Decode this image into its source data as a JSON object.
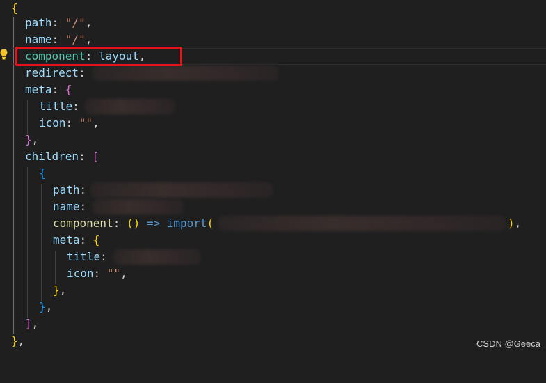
{
  "editor": {
    "lines": [
      {
        "open_brace": "{"
      },
      {
        "key": "path",
        "colon": ": ",
        "value": "\"/\"",
        "comma": ","
      },
      {
        "key": "name",
        "colon": ": ",
        "value": "\"/\"",
        "comma": ","
      },
      {
        "key": "component",
        "colon": ": ",
        "value": "layout",
        "comma": ","
      },
      {
        "key": "redirect",
        "colon": ":"
      },
      {
        "key": "meta",
        "colon": ": ",
        "bracket": "{"
      },
      {
        "key": "title",
        "colon": ":"
      },
      {
        "key": "icon",
        "colon": ": ",
        "value": "\"\"",
        "comma": ","
      },
      {
        "bracket": "}",
        "comma": ","
      },
      {
        "key": "children",
        "colon": ": ",
        "bracket": "["
      },
      {
        "bracket": "{"
      },
      {
        "key": "path",
        "colon": ":"
      },
      {
        "key": "name",
        "colon": ":"
      },
      {
        "key": "component",
        "colon": ": ",
        "parens": "()",
        "arrow": " => ",
        "fn": "import",
        "open": "(",
        "close": ")",
        "comma": ","
      },
      {
        "key": "meta",
        "colon": ": ",
        "bracket": "{"
      },
      {
        "key": "title",
        "colon": ":"
      },
      {
        "key": "icon",
        "colon": ": ",
        "value": "\"\"",
        "comma": ","
      },
      {
        "bracket": "}",
        "comma": ","
      },
      {
        "bracket": "}",
        "comma": ","
      },
      {
        "bracket": "]",
        "comma": ","
      },
      {
        "bracket": "}",
        "comma": ","
      }
    ]
  },
  "watermark": "CSDN @Geeca",
  "colors": {
    "background": "#1f1f1f",
    "highlight_border": "#e8141b",
    "key": "#9cdcfe",
    "string": "#ce9178",
    "bracket_level1": "#ffd700",
    "bracket_level2": "#da70d6",
    "bracket_level3": "#179fff"
  },
  "icons": {
    "gutter": "lightbulb-icon"
  }
}
